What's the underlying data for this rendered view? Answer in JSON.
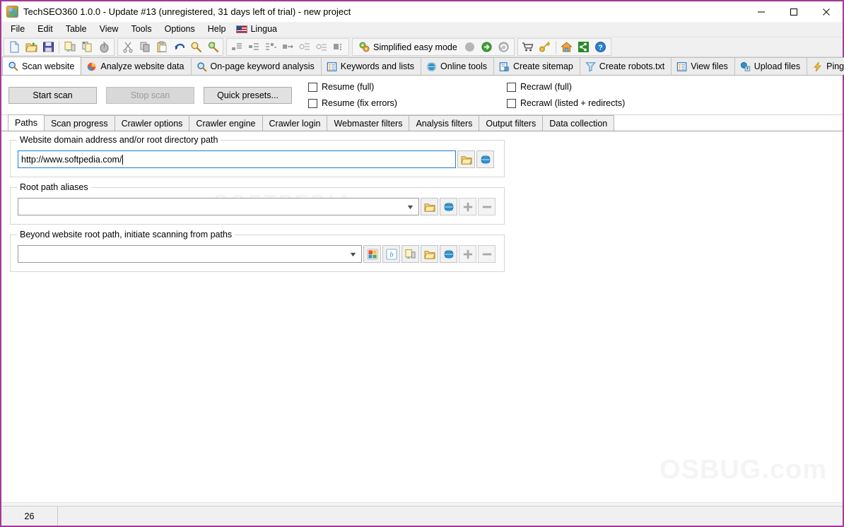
{
  "window": {
    "title": "TechSEO360 1.0.0 - Update #13 (unregistered, 31 days left of trial) - new project",
    "app_icon": "globe-app-icon",
    "border_color": "#a4389a",
    "controls": {
      "minimize": "—",
      "maximize": "□",
      "close": "✕"
    }
  },
  "menubar": {
    "items": [
      {
        "label": "File"
      },
      {
        "label": "Edit"
      },
      {
        "label": "Table"
      },
      {
        "label": "View"
      },
      {
        "label": "Tools"
      },
      {
        "label": "Options"
      },
      {
        "label": "Help"
      },
      {
        "label": "Lingua",
        "icon": "us-flag-icon"
      }
    ]
  },
  "toolbar": {
    "groups": [
      {
        "buttons": [
          {
            "icon": "new-document-icon",
            "name": "new-project"
          },
          {
            "icon": "open-folder-icon",
            "name": "open-project"
          },
          {
            "icon": "save-floppy-icon",
            "name": "save-project"
          },
          {
            "sep": true
          },
          {
            "icon": "import-icon",
            "name": "import"
          },
          {
            "icon": "export-icon",
            "name": "export"
          },
          {
            "icon": "mouse-icon",
            "name": "pointer-tool"
          }
        ]
      },
      {
        "buttons": [
          {
            "icon": "scissors-icon",
            "name": "cut"
          },
          {
            "icon": "copy-icon",
            "name": "copy"
          },
          {
            "icon": "paste-icon",
            "name": "paste"
          },
          {
            "icon": "undo-arrow-icon",
            "name": "undo"
          },
          {
            "icon": "magnifier-icon",
            "name": "find"
          },
          {
            "icon": "find-replace-icon",
            "name": "find-replace"
          }
        ]
      },
      {
        "buttons": [
          {
            "icon": "indent-list-icon",
            "name": "list-view-1"
          },
          {
            "icon": "tree-list-icon",
            "name": "list-view-2"
          },
          {
            "icon": "group-list-icon",
            "name": "list-view-3"
          },
          {
            "icon": "flow-right-icon",
            "name": "list-view-4"
          },
          {
            "icon": "collapse-icon",
            "name": "list-view-5"
          },
          {
            "icon": "expand-icon",
            "name": "list-view-6"
          },
          {
            "icon": "columns-icon",
            "name": "list-view-7"
          }
        ]
      },
      {
        "mode_label": "Simplified easy mode",
        "mode_icon": "gears-icon",
        "buttons": [
          {
            "icon": "gray-circle-icon",
            "name": "mode-state-idle"
          },
          {
            "icon": "green-go-icon",
            "name": "mode-state-go"
          },
          {
            "icon": "gray-refresh-icon",
            "name": "mode-state-refresh"
          }
        ]
      },
      {
        "buttons": [
          {
            "icon": "shopping-cart-icon",
            "name": "buy"
          },
          {
            "icon": "key-icon",
            "name": "license-key"
          },
          {
            "sep": true
          },
          {
            "icon": "home-icon",
            "name": "homepage"
          },
          {
            "icon": "share-icon",
            "name": "share"
          },
          {
            "icon": "help-icon",
            "name": "help"
          }
        ]
      }
    ]
  },
  "navtabs": {
    "items": [
      {
        "label": "Scan website",
        "icon": "magnifier-icon",
        "active": true
      },
      {
        "label": "Analyze website data",
        "icon": "pie-globe-icon",
        "active": false
      },
      {
        "label": "On-page keyword analysis",
        "icon": "magnifier-icon",
        "active": false
      },
      {
        "label": "Keywords and lists",
        "icon": "list-icon",
        "active": false
      },
      {
        "label": "Online tools",
        "icon": "globe-icon",
        "active": false
      },
      {
        "label": "Create sitemap",
        "icon": "sitemap-icon",
        "active": false
      },
      {
        "label": "Create robots.txt",
        "icon": "funnel-icon",
        "active": false
      },
      {
        "label": "View files",
        "icon": "list-icon",
        "active": false
      },
      {
        "label": "Upload files",
        "icon": "upload-icon",
        "active": false
      },
      {
        "label": "Ping sitema",
        "icon": "lightning-icon",
        "active": false
      }
    ],
    "scroll_left": "◄",
    "scroll_right": "►"
  },
  "actionbar": {
    "start_scan": "Start scan",
    "stop_scan": "Stop scan",
    "quick_presets": "Quick presets...",
    "checkboxes_left": [
      {
        "label": "Resume (full)",
        "checked": false
      },
      {
        "label": "Resume (fix errors)",
        "checked": false
      }
    ],
    "checkboxes_right": [
      {
        "label": "Recrawl (full)",
        "checked": false
      },
      {
        "label": "Recrawl (listed + redirects)",
        "checked": false
      }
    ]
  },
  "innertabs": {
    "items": [
      {
        "label": "Paths",
        "active": true
      },
      {
        "label": "Scan progress",
        "active": false
      },
      {
        "label": "Crawler options",
        "active": false
      },
      {
        "label": "Crawler engine",
        "active": false
      },
      {
        "label": "Crawler login",
        "active": false
      },
      {
        "label": "Webmaster filters",
        "active": false
      },
      {
        "label": "Analysis filters",
        "active": false
      },
      {
        "label": "Output filters",
        "active": false
      },
      {
        "label": "Data collection",
        "active": false
      }
    ]
  },
  "paths": {
    "domain_group": {
      "legend": "Website domain address and/or root directory path",
      "value": "http://www.softpedia.com/",
      "placeholder": "",
      "buttons": [
        {
          "icon": "folder-icon",
          "name": "browse-folder"
        },
        {
          "icon": "globe-icon",
          "name": "open-url"
        }
      ]
    },
    "aliases_group": {
      "legend": "Root path aliases",
      "value": "",
      "placeholder": "",
      "buttons": [
        {
          "icon": "folder-icon",
          "name": "browse-folder"
        },
        {
          "icon": "globe-icon",
          "name": "open-url"
        },
        {
          "icon": "plus-icon",
          "name": "add-alias"
        },
        {
          "icon": "minus-icon",
          "name": "remove-alias"
        }
      ]
    },
    "beyond_group": {
      "legend": "Beyond website root path, initiate scanning from paths",
      "value": "",
      "placeholder": "",
      "buttons": [
        {
          "icon": "google-icon",
          "name": "import-from-google"
        },
        {
          "icon": "bing-icon",
          "name": "import-from-bing"
        },
        {
          "icon": "import-icon",
          "name": "import-from-file"
        },
        {
          "icon": "folder-icon",
          "name": "browse-folder"
        },
        {
          "icon": "globe-icon",
          "name": "open-url"
        },
        {
          "icon": "plus-icon",
          "name": "add-path"
        },
        {
          "icon": "minus-icon",
          "name": "remove-path"
        }
      ]
    }
  },
  "statusbar": {
    "count": "26",
    "message": ""
  },
  "watermark": {
    "text": "OSBUG.com",
    "text2": "SOFTPEDIA"
  }
}
